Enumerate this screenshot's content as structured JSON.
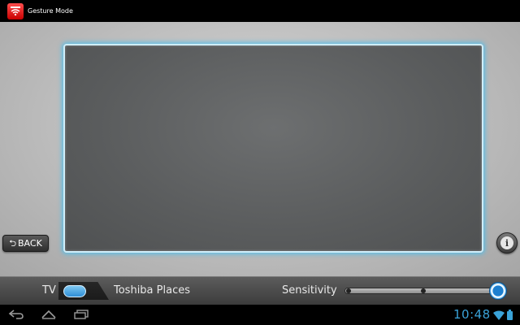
{
  "app": {
    "title": "Gesture Mode",
    "icon": "toshiba-remote-app-icon",
    "accent_color": "#e00000"
  },
  "main": {
    "back_button": {
      "label": "BACK",
      "icon": "back-arrow-icon"
    },
    "info_button": {
      "icon": "info-icon",
      "glyph": "i"
    }
  },
  "control_bar": {
    "mode_toggle": {
      "left_label": "TV",
      "right_label": "Toshiba Places",
      "selected": "TV",
      "accent_color": "#2f8ed6"
    },
    "sensitivity": {
      "label": "Sensitivity",
      "stops": 3,
      "value_fraction": 1.0
    }
  },
  "system_bar": {
    "clock": "10:48",
    "nav_buttons": [
      "back-nav-icon",
      "home-nav-icon",
      "recent-apps-icon"
    ],
    "status_icons": [
      "wifi-icon",
      "battery-icon"
    ],
    "accent_color": "#3aa3d9"
  }
}
